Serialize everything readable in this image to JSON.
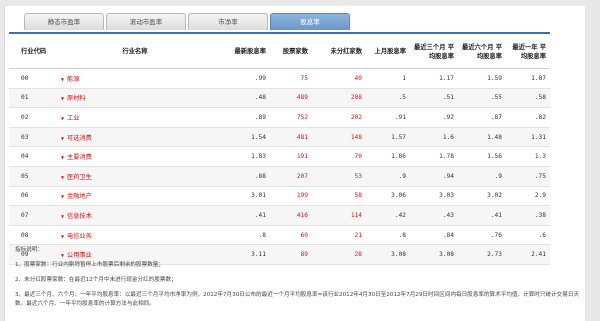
{
  "tabs": [
    {
      "label": "静态市盈率",
      "active": false
    },
    {
      "label": "滚动市盈率",
      "active": false
    },
    {
      "label": "市净率",
      "active": false
    },
    {
      "label": "股息率",
      "active": true
    }
  ],
  "table": {
    "headers": [
      "行业代码",
      "行业名称",
      "最新股息率",
      "股票家数",
      "未分红家数",
      "上月股息率",
      "最近三个月 平均股息率",
      "最近六个月 平均股息率",
      "最近一年 平均股息率"
    ],
    "rows": [
      {
        "code": "00",
        "name": "能源",
        "latest": ".99",
        "count": "75",
        "nodiv": "40",
        "lastmonth": "1",
        "avg3": "1.17",
        "avg6": "1.59",
        "avg12": "1.87"
      },
      {
        "code": "01",
        "name": "原材料",
        "latest": ".48",
        "count": "489",
        "nodiv": "208",
        "lastmonth": ".5",
        "avg3": ".51",
        "avg6": ".55",
        "avg12": ".58"
      },
      {
        "code": "02",
        "name": "工业",
        "latest": ".89",
        "count": "752",
        "nodiv": "202",
        "lastmonth": ".91",
        "avg3": ".92",
        "avg6": ".87",
        "avg12": ".82"
      },
      {
        "code": "03",
        "name": "可选消费",
        "latest": "1.54",
        "count": "481",
        "nodiv": "148",
        "lastmonth": "1.57",
        "avg3": "1.6",
        "avg6": "1.48",
        "avg12": "1.31"
      },
      {
        "code": "04",
        "name": "主要消费",
        "latest": "1.83",
        "count": "191",
        "nodiv": "70",
        "lastmonth": "1.86",
        "avg3": "1.78",
        "avg6": "1.56",
        "avg12": "1.3"
      },
      {
        "code": "05",
        "name": "医药卫生",
        "latest": ".88",
        "count": "207",
        "nodiv": "53",
        "lastmonth": ".9",
        "avg3": ".94",
        "avg6": ".9",
        "avg12": ".75"
      },
      {
        "code": "06",
        "name": "金融地产",
        "latest": "3.01",
        "count": "199",
        "nodiv": "58",
        "lastmonth": "3.06",
        "avg3": "3.03",
        "avg6": "3.02",
        "avg12": "2.9"
      },
      {
        "code": "07",
        "name": "信息技术",
        "latest": ".41",
        "count": "416",
        "nodiv": "114",
        "lastmonth": ".42",
        "avg3": ".43",
        "avg6": ".41",
        "avg12": ".38"
      },
      {
        "code": "08",
        "name": "电信业务",
        "latest": ".8",
        "count": "60",
        "nodiv": "21",
        "lastmonth": ".8",
        "avg3": ".84",
        "avg6": ".76",
        "avg12": ".6"
      },
      {
        "code": "09",
        "name": "公用事业",
        "latest": "3.11",
        "count": "89",
        "nodiv": "28",
        "lastmonth": "3.08",
        "avg3": "3.08",
        "avg6": "2.73",
        "avg12": "2.41"
      }
    ]
  },
  "notes": {
    "title": "指标说明：",
    "items": [
      "1、股票家数：行业内剔除暂停上市股票后剩余的股票数量；",
      "2、未分红股票家数：在最近12个月中未进行现金分红的股票数；",
      "3、最近三个月、六个月、一年平均股息率：以最近三个月平均市净率为例，2012年7月30日公布的最近一个月平均股息率=该行业2012年4月30日至2012年7月29日时间区间内每日股息率的算术平均值，计算时只统计交易日天数。最近六个月、一年平均股息率的计算方法与此相同。"
    ]
  },
  "colors": {
    "active_tab": "#6b98c7",
    "accent_line": "#3c6fa9",
    "highlight": "#dd1111"
  }
}
